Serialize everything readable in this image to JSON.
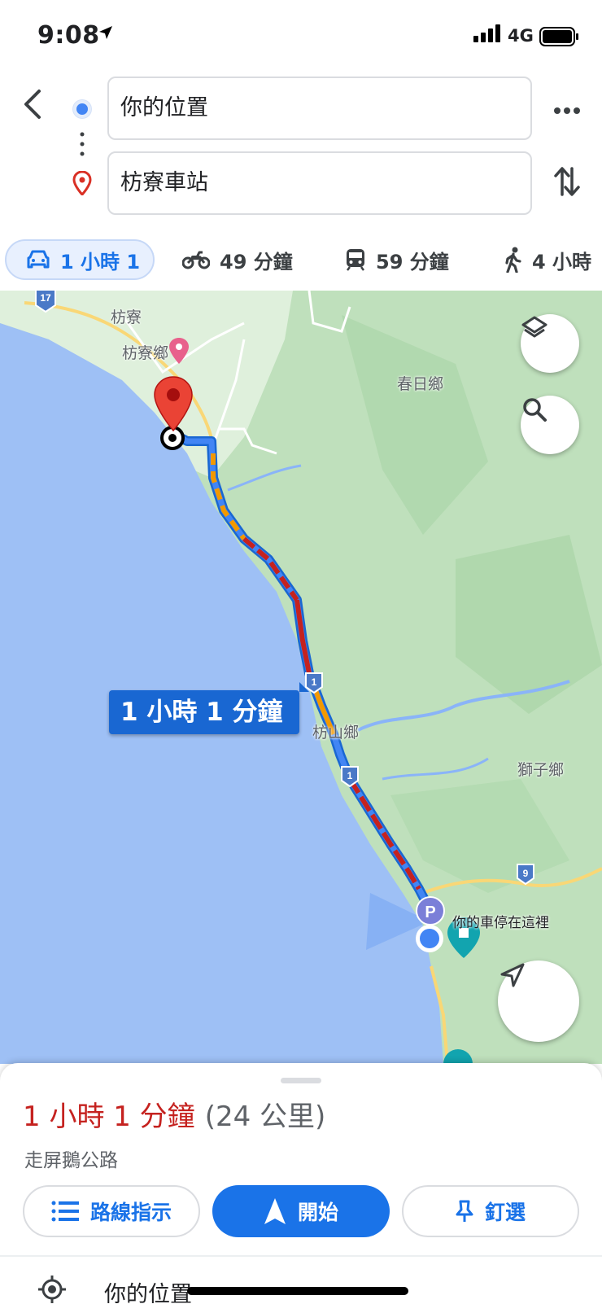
{
  "status_bar": {
    "time": "9:08",
    "network": "4G"
  },
  "directions": {
    "origin": "你的位置",
    "destination": "枋寮車站"
  },
  "modes": [
    {
      "name": "drive",
      "label": "1 小時 1",
      "active": true
    },
    {
      "name": "motorcycle",
      "label": "49 分鐘"
    },
    {
      "name": "transit",
      "label": "59 分鐘"
    },
    {
      "name": "walk",
      "label": "4 小時"
    }
  ],
  "map": {
    "labels": {
      "fangliao": "枋寮",
      "fangliao_township": "枋寮鄉",
      "chunri": "春日鄉",
      "fangshan": "枋山鄉",
      "shizi": "獅子鄉",
      "car_parked": "你的車停在這裡"
    },
    "route_callout": "1 小時 1 分鐘",
    "road_shields": [
      "17",
      "1",
      "1",
      "9"
    ],
    "parking_badge": "P",
    "colors": {
      "sea": "#9ec0f5",
      "land": "#b8dcb7",
      "route_blue": "#4285f4",
      "traffic_red": "#c5221f",
      "traffic_orange": "#f29900"
    }
  },
  "sheet": {
    "duration": "1 小時 1 分鐘",
    "distance": "(24 公里)",
    "via": "走屏鵝公路",
    "buttons": {
      "steps": "路線指示",
      "start": "開始",
      "pin": "釘選"
    },
    "first_step": "你的位置"
  }
}
